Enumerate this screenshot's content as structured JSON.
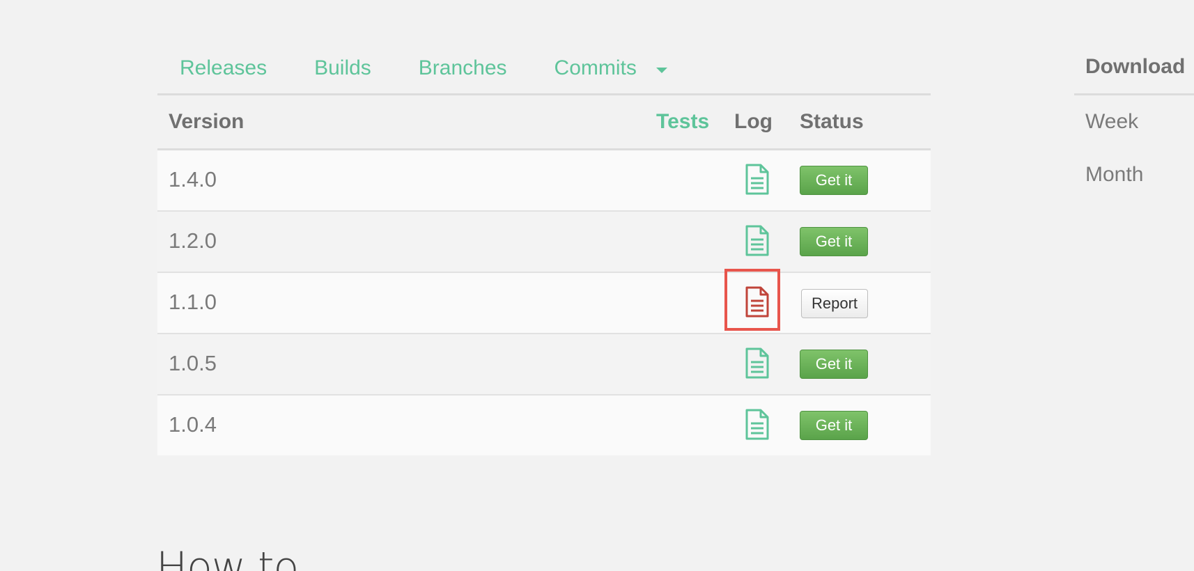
{
  "tabs": [
    {
      "label": "Releases"
    },
    {
      "label": "Builds"
    },
    {
      "label": "Branches"
    },
    {
      "label": "Commits"
    }
  ],
  "table": {
    "headers": {
      "version": "Version",
      "tests": "Tests",
      "log": "Log",
      "status": "Status"
    },
    "rows": [
      {
        "version": "1.4.0",
        "status": "Get it",
        "log_icon": "file-text-icon",
        "log_color": "#5ec49a"
      },
      {
        "version": "1.2.0",
        "status": "Get it",
        "log_icon": "file-text-icon",
        "log_color": "#5ec49a"
      },
      {
        "version": "1.1.0",
        "status": "Report",
        "log_icon": "file-text-icon",
        "log_color": "#c0443a"
      },
      {
        "version": "1.0.5",
        "status": "Get it",
        "log_icon": "file-text-icon",
        "log_color": "#5ec49a"
      },
      {
        "version": "1.0.4",
        "status": "Get it",
        "log_icon": "file-text-icon",
        "log_color": "#5ec49a"
      }
    ]
  },
  "downloads": {
    "title": "Download",
    "week_label": "Week",
    "month_label": "Month"
  },
  "section": {
    "heading": "How to"
  },
  "colors": {
    "accent": "#5ec49a",
    "success": "#6ab55a",
    "error": "#c0443a",
    "highlight": "#e8554c"
  }
}
